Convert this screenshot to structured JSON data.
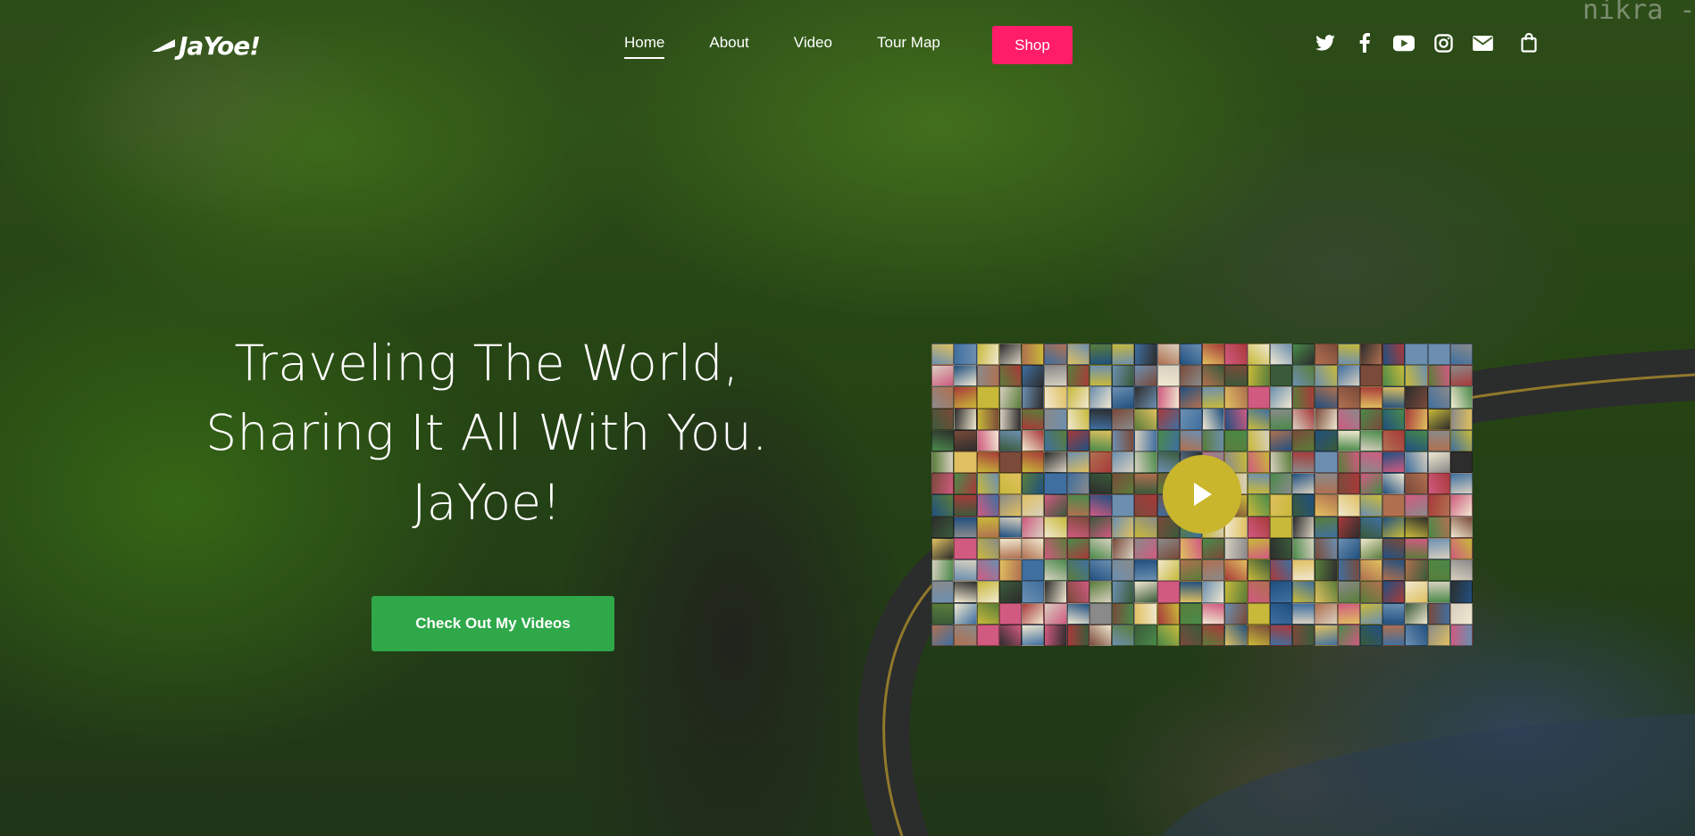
{
  "brand": {
    "logo_text": "JaYoe!"
  },
  "nav": {
    "items": [
      {
        "label": "Home",
        "active": true
      },
      {
        "label": "About",
        "active": false
      },
      {
        "label": "Video",
        "active": false
      },
      {
        "label": "Tour Map",
        "active": false
      }
    ],
    "shop_label": "Shop"
  },
  "social": {
    "icons": [
      "twitter-icon",
      "facebook-icon",
      "youtube-icon",
      "instagram-icon",
      "email-icon",
      "shopping-bag-icon"
    ]
  },
  "watermark": "nikra -",
  "hero": {
    "headline_line1": "Traveling The World,",
    "headline_line2": "Sharing It All With You.",
    "headline_line3": "JaYoe!",
    "cta_label": "Check Out My Videos"
  },
  "video": {
    "play_icon": "play-icon"
  },
  "colors": {
    "shop": "#ff1c68",
    "cta": "#2fa84a",
    "play": "#c9b62c"
  }
}
